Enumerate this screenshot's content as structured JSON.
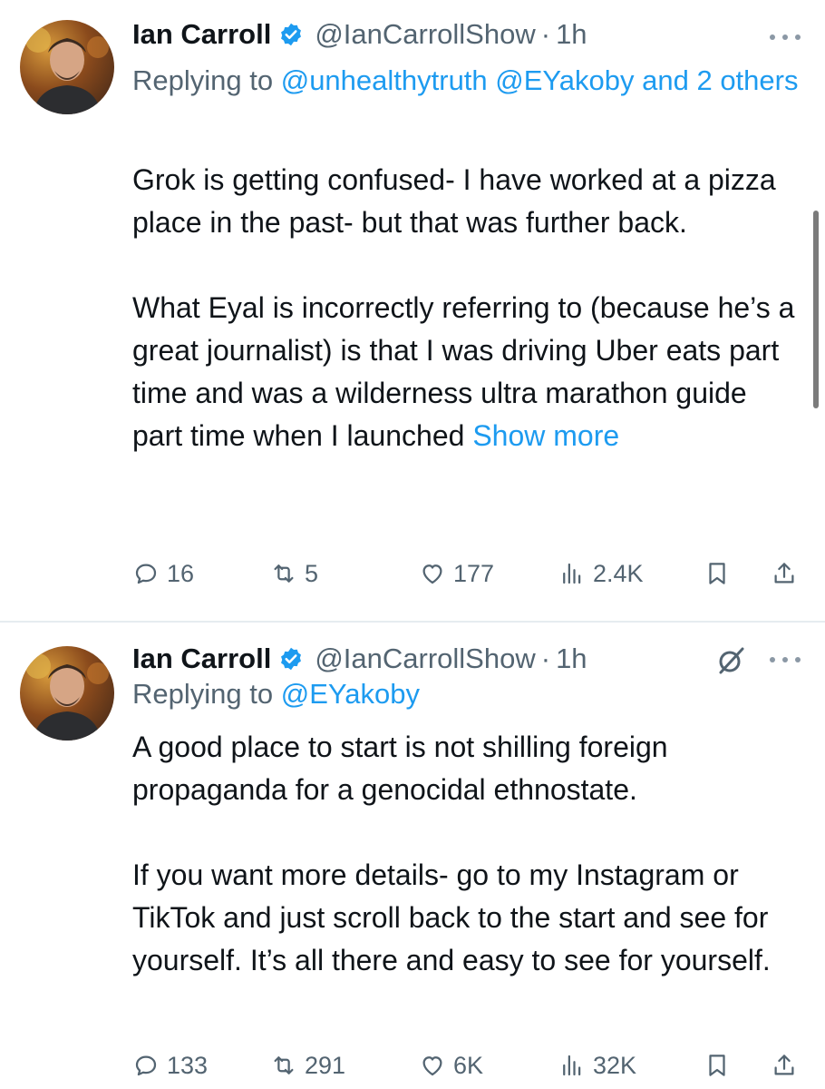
{
  "tweets": [
    {
      "display_name": "Ian Carroll",
      "handle": "@IanCarrollShow",
      "separator": "·",
      "time": "1h",
      "reply_prefix": "Replying to ",
      "reply_mentions": "@unhealthytruth @EYakoby and 2 others",
      "body": {
        "p1": "Grok is getting confused- I have worked at a pizza place in the past- but that was further back.",
        "p2": "What Eyal is incorrectly referring to (because he’s a great journalist) is that I was driving Uber eats part time and was a wilderness ultra marathon guide part time when I launched",
        "show_more": "Show more"
      },
      "stats": {
        "replies": "16",
        "reposts": "5",
        "likes": "177",
        "views": "2.4K"
      }
    },
    {
      "display_name": "Ian Carroll",
      "handle": "@IanCarrollShow",
      "separator": "·",
      "time": "1h",
      "reply_prefix": "Replying to ",
      "reply_mentions": "@EYakoby",
      "body": {
        "p1": "A good place to start is not shilling foreign propaganda for a genocidal ethnostate.",
        "p2": "If you want more details- go to my Instagram or TikTok and just scroll back to the start and see for yourself. It’s all there and easy to see for yourself."
      },
      "stats": {
        "replies": "133",
        "reposts": "291",
        "likes": "6K",
        "views": "32K"
      }
    }
  ],
  "colors": {
    "link": "#1d9bf0",
    "secondary_text": "#536471",
    "primary_text": "#0f1419",
    "divider": "#e6ecf0"
  },
  "icons": [
    "verified-badge-icon",
    "more-icon",
    "grok-icon",
    "reply-icon",
    "repost-icon",
    "like-icon",
    "views-icon",
    "bookmark-icon",
    "share-icon"
  ]
}
